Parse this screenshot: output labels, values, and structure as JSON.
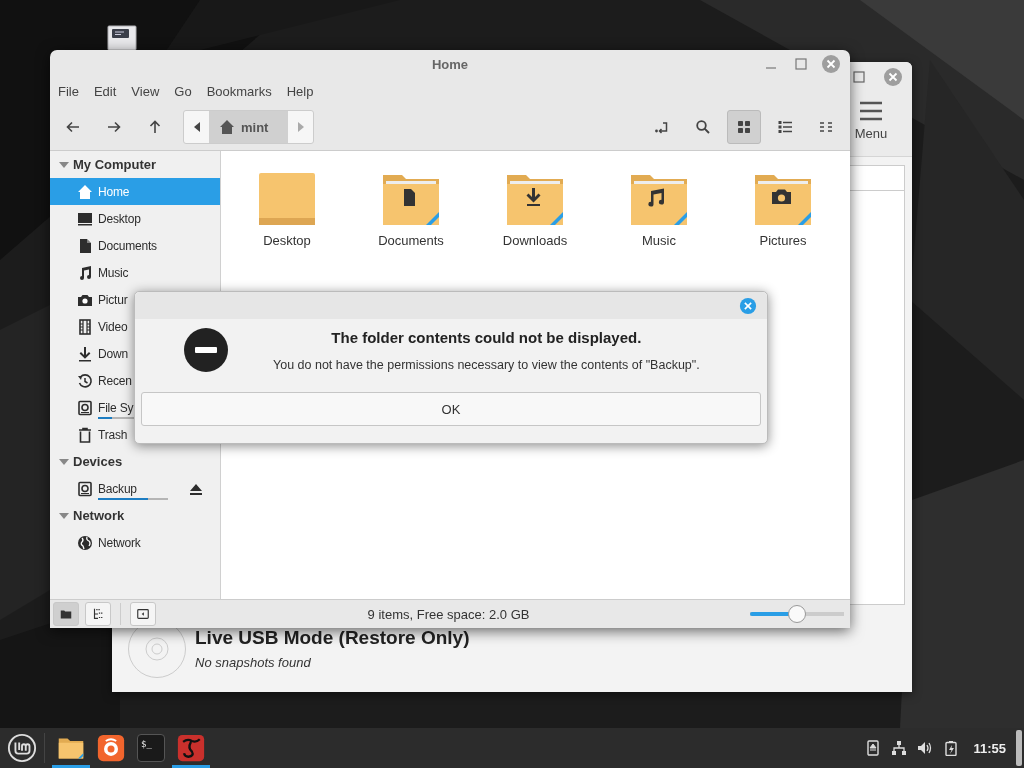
{
  "background_window": {
    "menu_button": "Menu",
    "snapshot": {
      "title": "Live USB Mode (Restore Only)",
      "subtitle": "No snapshots found"
    }
  },
  "window": {
    "title": "Home",
    "menu": [
      "File",
      "Edit",
      "View",
      "Go",
      "Bookmarks",
      "Help"
    ],
    "path": [
      {
        "label": "mint",
        "kind": "home",
        "selected": true
      }
    ],
    "view_modes": [
      {
        "kind": "icons",
        "selected": true
      },
      {
        "kind": "list",
        "selected": false
      },
      {
        "kind": "compact",
        "selected": false
      }
    ],
    "sidebar": [
      {
        "title": "My Computer",
        "expanded": true,
        "items": [
          {
            "label": "Home",
            "kind": "home",
            "selected": true
          },
          {
            "label": "Desktop",
            "kind": "desktop",
            "selected": false
          },
          {
            "label": "Documents",
            "kind": "document",
            "selected": false
          },
          {
            "label": "Music",
            "kind": "music",
            "selected": false
          },
          {
            "label": "Pictur",
            "kind": "camera",
            "selected": false
          },
          {
            "label": "Video",
            "kind": "film",
            "selected": false
          },
          {
            "label": "Down",
            "kind": "download",
            "selected": false
          },
          {
            "label": "Recen",
            "kind": "history",
            "selected": false
          },
          {
            "label": "File Sy",
            "kind": "drive",
            "selected": false,
            "level": 0.2
          },
          {
            "label": "Trash",
            "kind": "trash",
            "selected": false
          }
        ]
      },
      {
        "title": "Devices",
        "expanded": true,
        "items": [
          {
            "label": "Backup",
            "kind": "drive",
            "selected": false,
            "level": 0.72,
            "eject": true
          }
        ]
      },
      {
        "title": "Network",
        "expanded": true,
        "items": [
          {
            "label": "Network",
            "kind": "globe",
            "selected": false
          }
        ]
      }
    ],
    "files": [
      {
        "name": "Desktop",
        "kind": "desktop"
      },
      {
        "name": "Documents",
        "kind": "document"
      },
      {
        "name": "Downloads",
        "kind": "download"
      },
      {
        "name": "Music",
        "kind": "music"
      },
      {
        "name": "Pictures",
        "kind": "camera"
      }
    ],
    "status_bar": {
      "panes": [
        {
          "kind": "places",
          "selected": true
        },
        {
          "kind": "tree",
          "selected": false
        }
      ],
      "text": "9 items, Free space: 2.0 GB",
      "zoom": {
        "level": 0.49
      }
    }
  },
  "dialog": {
    "title": "The folder contents could not be displayed.",
    "message": "You do not have the permissions necessary to view the contents of \"Backup\".",
    "buttons": [
      "OK"
    ]
  },
  "taskbar": {
    "apps": [
      {
        "kind": "files",
        "running": true
      },
      {
        "kind": "browser",
        "running": false
      },
      {
        "kind": "terminal",
        "running": false,
        "glyph": "$_"
      },
      {
        "kind": "editor",
        "running": true
      }
    ],
    "clock": "11:55"
  }
}
